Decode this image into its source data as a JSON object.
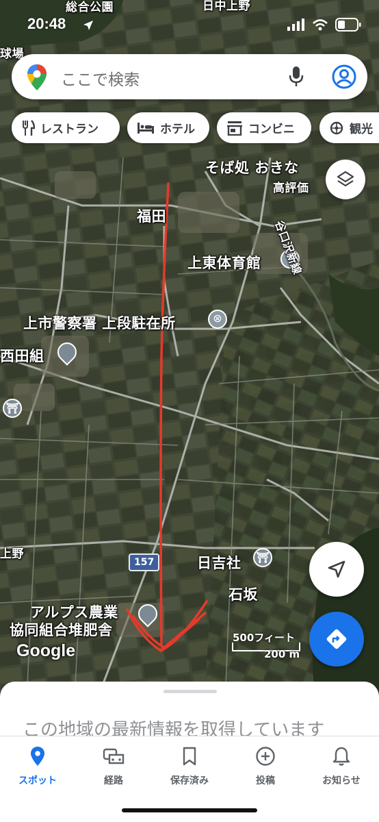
{
  "status_bar": {
    "time": "20:48"
  },
  "search": {
    "placeholder": "ここで検索"
  },
  "chips": [
    {
      "label": "レストラン",
      "icon": "restaurant-icon"
    },
    {
      "label": "ホテル",
      "icon": "hotel-icon"
    },
    {
      "label": "コンビニ",
      "icon": "store-icon"
    },
    {
      "label": "観光",
      "icon": "attraction-icon"
    }
  ],
  "map_labels": {
    "sougou_kouen": "総合公園",
    "kyujo": "球場",
    "hinaka_kamino": "日中上野",
    "soba": "そば処 おきな",
    "soba_rating": "高評価",
    "fukuda": "福田",
    "kamitou_taiikukan": "上東体育館",
    "taniguchizawa_line": "谷口沢新線",
    "keisatsusho": "上市警察署 上段駐在所",
    "nishida": "西田組",
    "kamino": "上野",
    "hiyoshisha": "日吉社",
    "ishizaka": "石坂",
    "alps_1": "アルプス農業",
    "alps_2": "協同組合堆肥舎",
    "route_number": "157"
  },
  "scale": {
    "imperial": "500フィート",
    "metric": "200 m"
  },
  "google_logo": "Google",
  "sheet": {
    "text": "この地域の最新情報を取得しています"
  },
  "nav": [
    {
      "label": "スポット",
      "icon": "location-pin-icon",
      "active": true
    },
    {
      "label": "経路",
      "icon": "car-icon",
      "active": false
    },
    {
      "label": "保存済み",
      "icon": "bookmark-icon",
      "active": false
    },
    {
      "label": "投稿",
      "icon": "add-circle-icon",
      "active": false
    },
    {
      "label": "お知らせ",
      "icon": "bell-icon",
      "active": false
    }
  ],
  "colors": {
    "accent": "#1a73e8",
    "annotation": "#e53a2a"
  }
}
